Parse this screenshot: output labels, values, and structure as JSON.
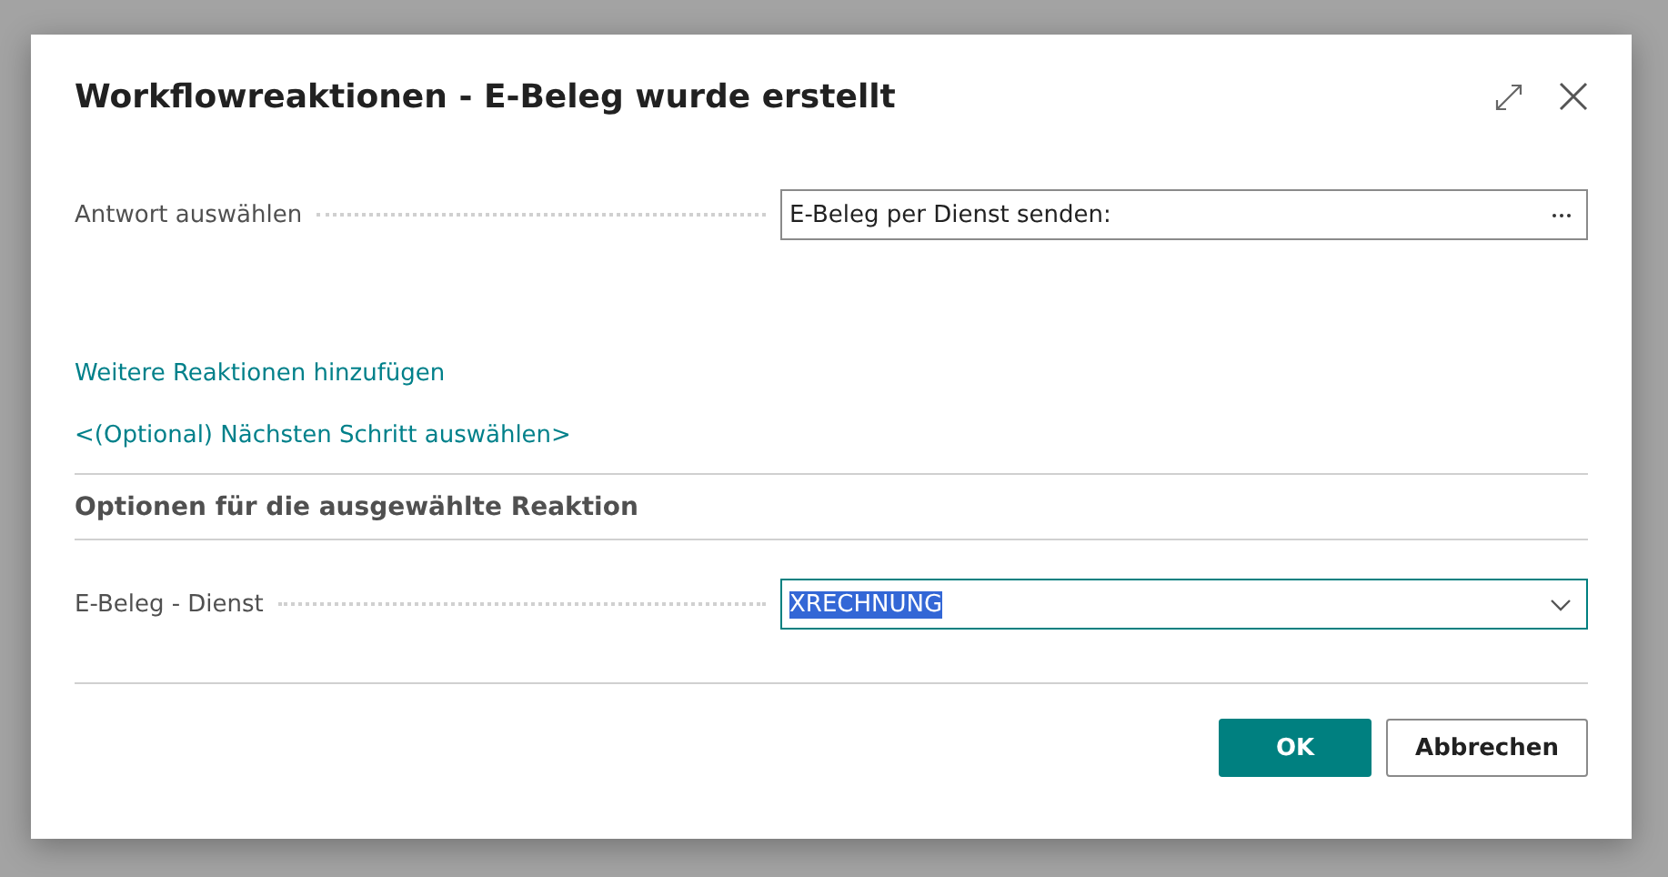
{
  "dialog": {
    "title": "Workflowreaktionen - E-Beleg wurde erstellt",
    "response_field": {
      "label": "Antwort auswählen",
      "value": "E-Beleg per Dienst senden:"
    },
    "links": [
      "Weitere Reaktionen hinzufügen",
      "<(Optional) Nächsten Schritt auswählen>"
    ],
    "options_heading": "Optionen für die ausgewählte Reaktion",
    "service_field": {
      "label": "E-Beleg - Dienst",
      "value": "XRECHNUNG",
      "highlighted": true
    },
    "buttons": [
      {
        "label": "OK",
        "kind": "primary"
      },
      {
        "label": "Abbrechen",
        "kind": "secondary"
      }
    ]
  }
}
